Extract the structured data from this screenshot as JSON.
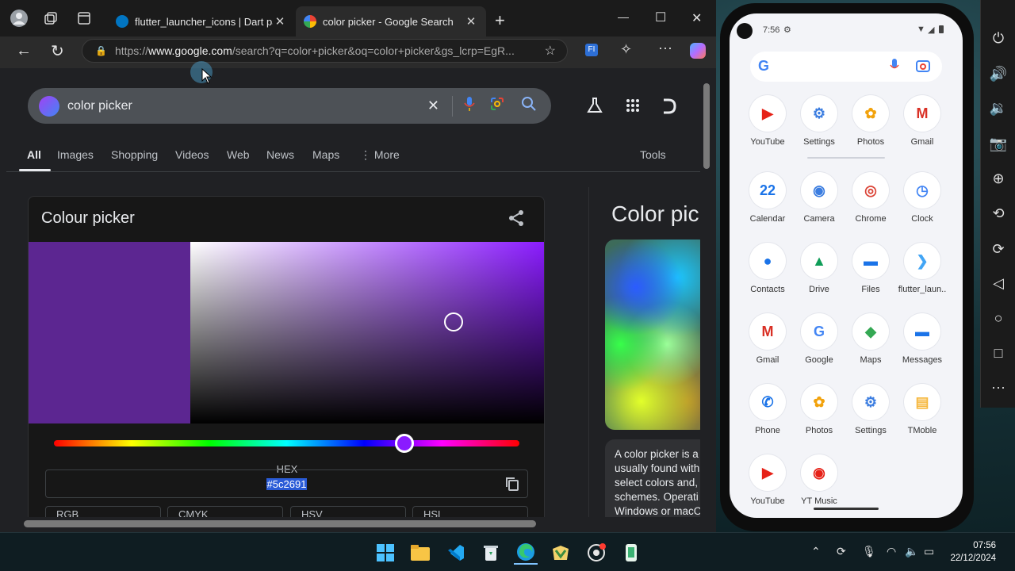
{
  "browser": {
    "tabs": [
      {
        "title": "flutter_launcher_icons | Dart packa",
        "active": false
      },
      {
        "title": "color picker - Google Search",
        "active": true
      }
    ],
    "new_tab": "+",
    "address": {
      "prefix": "https://",
      "host": "www.google.com",
      "path": "/search?q=color+picker&oq=color+picker&gs_lcrp=EgR..."
    },
    "window_controls": {
      "minimize": "—",
      "maximize": "☐",
      "close": "✕"
    }
  },
  "google": {
    "query": "color picker",
    "nav_tabs": [
      "All",
      "Images",
      "Shopping",
      "Videos",
      "Web",
      "News",
      "Maps",
      "⋮ More"
    ],
    "tools": "Tools",
    "picker_card": {
      "title": "Colour picker",
      "hex_label": "HEX",
      "hex_value": "#5c2691",
      "selected_color": "#5c2691",
      "hue_color": "#8a1bff",
      "models": [
        "RGB",
        "CMYK",
        "HSV",
        "HSL"
      ]
    },
    "knowledge_panel": {
      "title": "Color pic",
      "text_lines": [
        "A color picker is a",
        "usually found with",
        "select colors and,",
        "schemes. Operati",
        "Windows or macO"
      ]
    }
  },
  "phone": {
    "time": "7:56",
    "apps": [
      {
        "label": "YouTube",
        "glyph": "▶",
        "color": "#e62117"
      },
      {
        "label": "Settings",
        "glyph": "⚙",
        "color": "#3b7de0"
      },
      {
        "label": "Photos",
        "glyph": "✿",
        "color": "#f2a20c"
      },
      {
        "label": "Gmail",
        "glyph": "M",
        "color": "#d93025"
      },
      {
        "label": "Calendar",
        "glyph": "22",
        "color": "#1a73e8"
      },
      {
        "label": "Camera",
        "glyph": "◉",
        "color": "#3b7de0"
      },
      {
        "label": "Chrome",
        "glyph": "◎",
        "color": "#db4437"
      },
      {
        "label": "Clock",
        "glyph": "◷",
        "color": "#4285f4"
      },
      {
        "label": "Contacts",
        "glyph": "●",
        "color": "#1a73e8"
      },
      {
        "label": "Drive",
        "glyph": "▲",
        "color": "#0f9d58"
      },
      {
        "label": "Files",
        "glyph": "▬",
        "color": "#1a73e8"
      },
      {
        "label": "flutter_laun..",
        "glyph": "❯",
        "color": "#42a5f5"
      },
      {
        "label": "Gmail",
        "glyph": "M",
        "color": "#d93025"
      },
      {
        "label": "Google",
        "glyph": "G",
        "color": "#4285f4"
      },
      {
        "label": "Maps",
        "glyph": "◆",
        "color": "#34a853"
      },
      {
        "label": "Messages",
        "glyph": "▬",
        "color": "#1a73e8"
      },
      {
        "label": "Phone",
        "glyph": "✆",
        "color": "#1a73e8"
      },
      {
        "label": "Photos",
        "glyph": "✿",
        "color": "#f2a20c"
      },
      {
        "label": "Settings",
        "glyph": "⚙",
        "color": "#3b7de0"
      },
      {
        "label": "TMoble",
        "glyph": "▤",
        "color": "#f6b73c"
      },
      {
        "label": "YouTube",
        "glyph": "▶",
        "color": "#e62117"
      },
      {
        "label": "YT Music",
        "glyph": "◉",
        "color": "#e62117"
      }
    ]
  },
  "taskbar": {
    "time": "07:56",
    "date": "22/12/2024"
  }
}
